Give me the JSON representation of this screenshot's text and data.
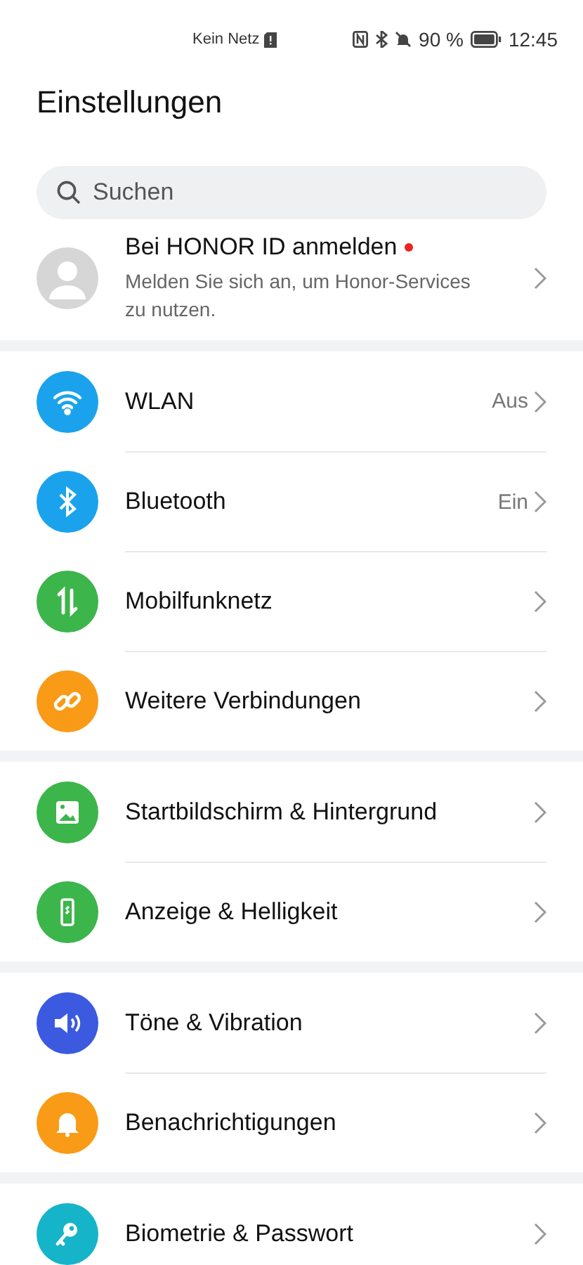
{
  "status_bar": {
    "carrier": "Kein Netz",
    "battery": "90 %",
    "time": "12:45"
  },
  "title": "Einstellungen",
  "search": {
    "placeholder": "Suchen"
  },
  "account": {
    "title": "Bei HONOR ID anmelden",
    "subtitle": "Melden Sie sich an, um Honor-Services zu nutzen.",
    "notification_dot": true
  },
  "groups": [
    {
      "items": [
        {
          "kind": "wifi",
          "color": "#1aa3ec",
          "label": "WLAN",
          "value": "Aus"
        },
        {
          "kind": "bluetooth",
          "color": "#1aa3ec",
          "label": "Bluetooth",
          "value": "Ein"
        },
        {
          "kind": "mobile-data",
          "color": "#3cb54a",
          "label": "Mobilfunknetz"
        },
        {
          "kind": "link",
          "color": "#f99b16",
          "label": "Weitere Verbindungen"
        }
      ]
    },
    {
      "items": [
        {
          "kind": "image",
          "color": "#3cb54a",
          "label": "Startbildschirm & Hintergrund"
        },
        {
          "kind": "phone",
          "color": "#3cb54a",
          "label": "Anzeige & Helligkeit"
        }
      ]
    },
    {
      "items": [
        {
          "kind": "sound",
          "color": "#3b5ae0",
          "label": "Töne & Vibration"
        },
        {
          "kind": "bell",
          "color": "#f99b16",
          "label": "Benachrichtigungen"
        }
      ]
    },
    {
      "items": [
        {
          "kind": "key",
          "color": "#16b4c8",
          "label": "Biometrie & Passwort"
        }
      ]
    }
  ]
}
